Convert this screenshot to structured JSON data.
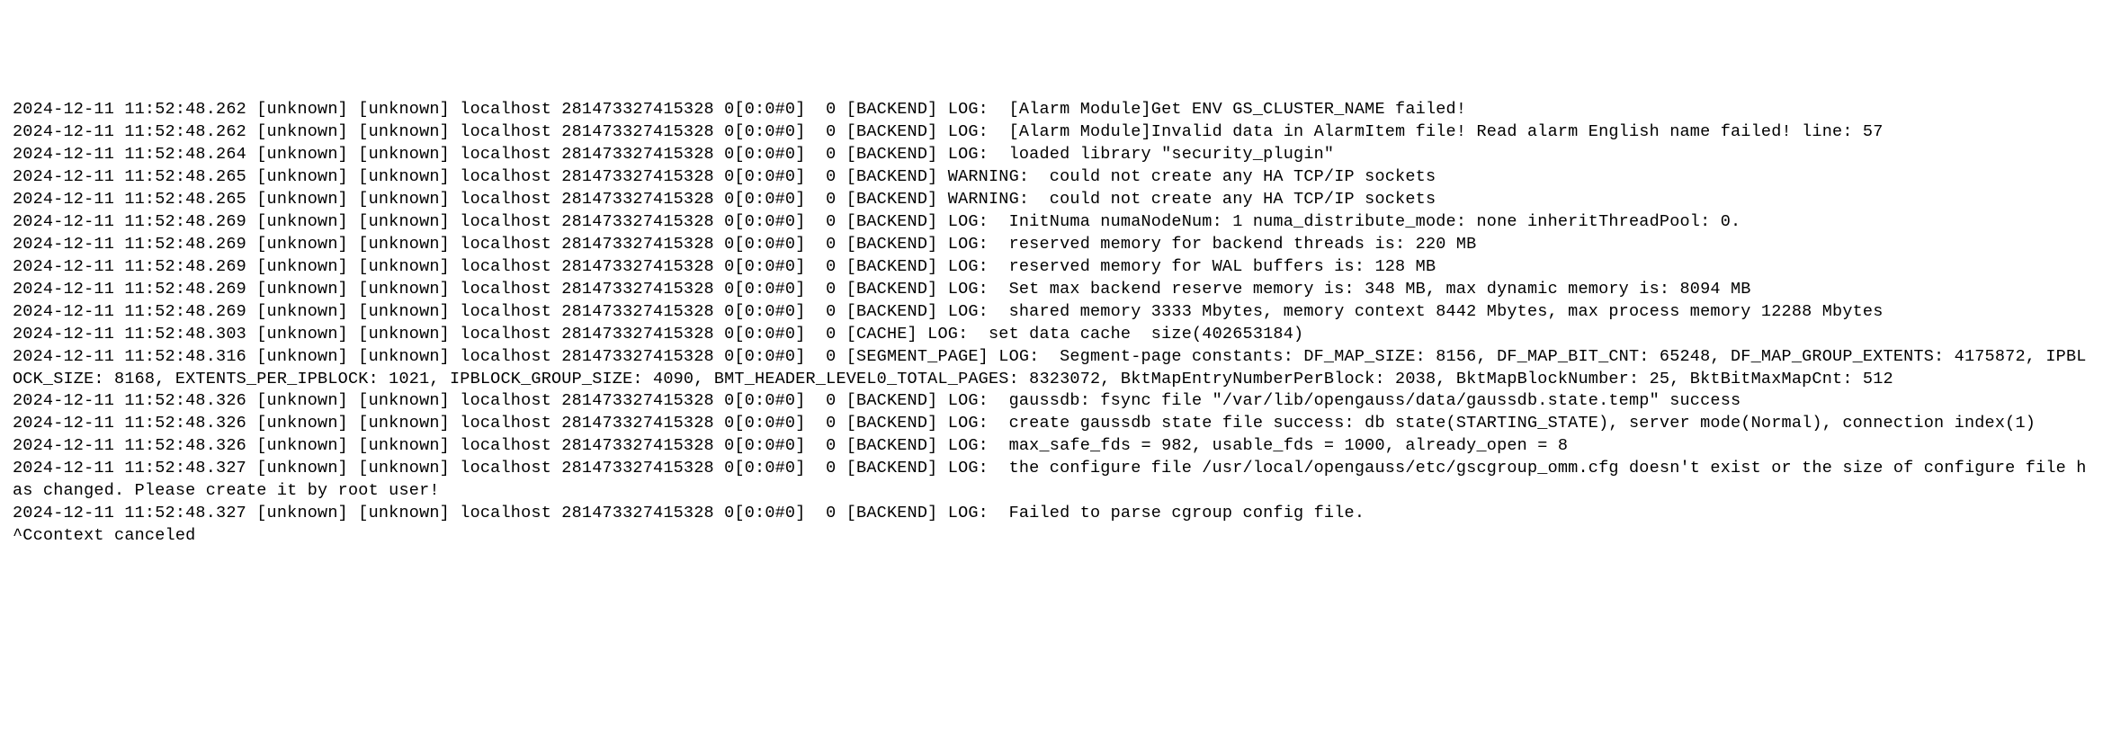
{
  "log": {
    "lines": [
      "2024-12-11 11:52:48.262 [unknown] [unknown] localhost 281473327415328 0[0:0#0]  0 [BACKEND] LOG:  [Alarm Module]Get ENV GS_CLUSTER_NAME failed!",
      "",
      "2024-12-11 11:52:48.262 [unknown] [unknown] localhost 281473327415328 0[0:0#0]  0 [BACKEND] LOG:  [Alarm Module]Invalid data in AlarmItem file! Read alarm English name failed! line: 57",
      "",
      "2024-12-11 11:52:48.264 [unknown] [unknown] localhost 281473327415328 0[0:0#0]  0 [BACKEND] LOG:  loaded library \"security_plugin\"",
      "2024-12-11 11:52:48.265 [unknown] [unknown] localhost 281473327415328 0[0:0#0]  0 [BACKEND] WARNING:  could not create any HA TCP/IP sockets",
      "2024-12-11 11:52:48.265 [unknown] [unknown] localhost 281473327415328 0[0:0#0]  0 [BACKEND] WARNING:  could not create any HA TCP/IP sockets",
      "2024-12-11 11:52:48.269 [unknown] [unknown] localhost 281473327415328 0[0:0#0]  0 [BACKEND] LOG:  InitNuma numaNodeNum: 1 numa_distribute_mode: none inheritThreadPool: 0.",
      "2024-12-11 11:52:48.269 [unknown] [unknown] localhost 281473327415328 0[0:0#0]  0 [BACKEND] LOG:  reserved memory for backend threads is: 220 MB",
      "2024-12-11 11:52:48.269 [unknown] [unknown] localhost 281473327415328 0[0:0#0]  0 [BACKEND] LOG:  reserved memory for WAL buffers is: 128 MB",
      "2024-12-11 11:52:48.269 [unknown] [unknown] localhost 281473327415328 0[0:0#0]  0 [BACKEND] LOG:  Set max backend reserve memory is: 348 MB, max dynamic memory is: 8094 MB",
      "2024-12-11 11:52:48.269 [unknown] [unknown] localhost 281473327415328 0[0:0#0]  0 [BACKEND] LOG:  shared memory 3333 Mbytes, memory context 8442 Mbytes, max process memory 12288 Mbytes",
      "2024-12-11 11:52:48.303 [unknown] [unknown] localhost 281473327415328 0[0:0#0]  0 [CACHE] LOG:  set data cache  size(402653184)",
      "2024-12-11 11:52:48.316 [unknown] [unknown] localhost 281473327415328 0[0:0#0]  0 [SEGMENT_PAGE] LOG:  Segment-page constants: DF_MAP_SIZE: 8156, DF_MAP_BIT_CNT: 65248, DF_MAP_GROUP_EXTENTS: 4175872, IPBLOCK_SIZE: 8168, EXTENTS_PER_IPBLOCK: 1021, IPBLOCK_GROUP_SIZE: 4090, BMT_HEADER_LEVEL0_TOTAL_PAGES: 8323072, BktMapEntryNumberPerBlock: 2038, BktMapBlockNumber: 25, BktBitMaxMapCnt: 512",
      "2024-12-11 11:52:48.326 [unknown] [unknown] localhost 281473327415328 0[0:0#0]  0 [BACKEND] LOG:  gaussdb: fsync file \"/var/lib/opengauss/data/gaussdb.state.temp\" success",
      "2024-12-11 11:52:48.326 [unknown] [unknown] localhost 281473327415328 0[0:0#0]  0 [BACKEND] LOG:  create gaussdb state file success: db state(STARTING_STATE), server mode(Normal), connection index(1)",
      "2024-12-11 11:52:48.326 [unknown] [unknown] localhost 281473327415328 0[0:0#0]  0 [BACKEND] LOG:  max_safe_fds = 982, usable_fds = 1000, already_open = 8",
      "2024-12-11 11:52:48.327 [unknown] [unknown] localhost 281473327415328 0[0:0#0]  0 [BACKEND] LOG:  the configure file /usr/local/opengauss/etc/gscgroup_omm.cfg doesn't exist or the size of configure file has changed. Please create it by root user!",
      "2024-12-11 11:52:48.327 [unknown] [unknown] localhost 281473327415328 0[0:0#0]  0 [BACKEND] LOG:  Failed to parse cgroup config file.",
      "^Ccontext canceled"
    ]
  }
}
